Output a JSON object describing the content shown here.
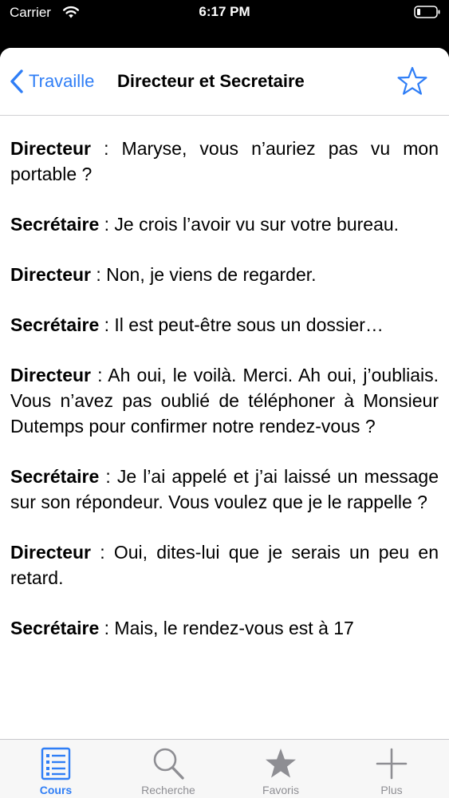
{
  "status_bar": {
    "carrier": "Carrier",
    "time": "6:17 PM"
  },
  "nav": {
    "back_label": "Travaille",
    "title": "Directeur et Secretaire",
    "favorite_icon": "star-outline-icon"
  },
  "colors": {
    "accent": "#2f7ef6",
    "inactive": "#8e8e93"
  },
  "dialogue": [
    {
      "speaker": "Directeur",
      "text": " : Maryse, vous n’auriez pas vu mon portable ?"
    },
    {
      "speaker": "Secrétaire",
      "text": " : Je crois l’avoir vu sur votre bureau."
    },
    {
      "speaker": "Directeur",
      "text": " : Non, je viens de regarder."
    },
    {
      "speaker": "Secrétaire",
      "text": " : Il est peut-être sous un dossier…"
    },
    {
      "speaker": "Directeur",
      "text": " : Ah oui, le voilà. Merci. Ah oui, j’oubliais. Vous n’avez pas oublié de téléphoner à Monsieur Dutemps pour confirmer notre rendez-vous ?"
    },
    {
      "speaker": "Secrétaire",
      "text": " : Je l’ai appelé et j’ai laissé un message sur son répondeur. Vous voulez  que je le rappelle ?"
    },
    {
      "speaker": "Directeur",
      "text": " : Oui, dites-lui que je serais un peu en retard."
    },
    {
      "speaker": "Secrétaire",
      "text": " : Mais, le rendez-vous est à 17"
    }
  ],
  "tabs": [
    {
      "label": "Cours",
      "icon": "list-icon",
      "active": true
    },
    {
      "label": "Recherche",
      "icon": "search-icon",
      "active": false
    },
    {
      "label": "Favoris",
      "icon": "star-icon",
      "active": false
    },
    {
      "label": "Plus",
      "icon": "plus-icon",
      "active": false
    }
  ]
}
